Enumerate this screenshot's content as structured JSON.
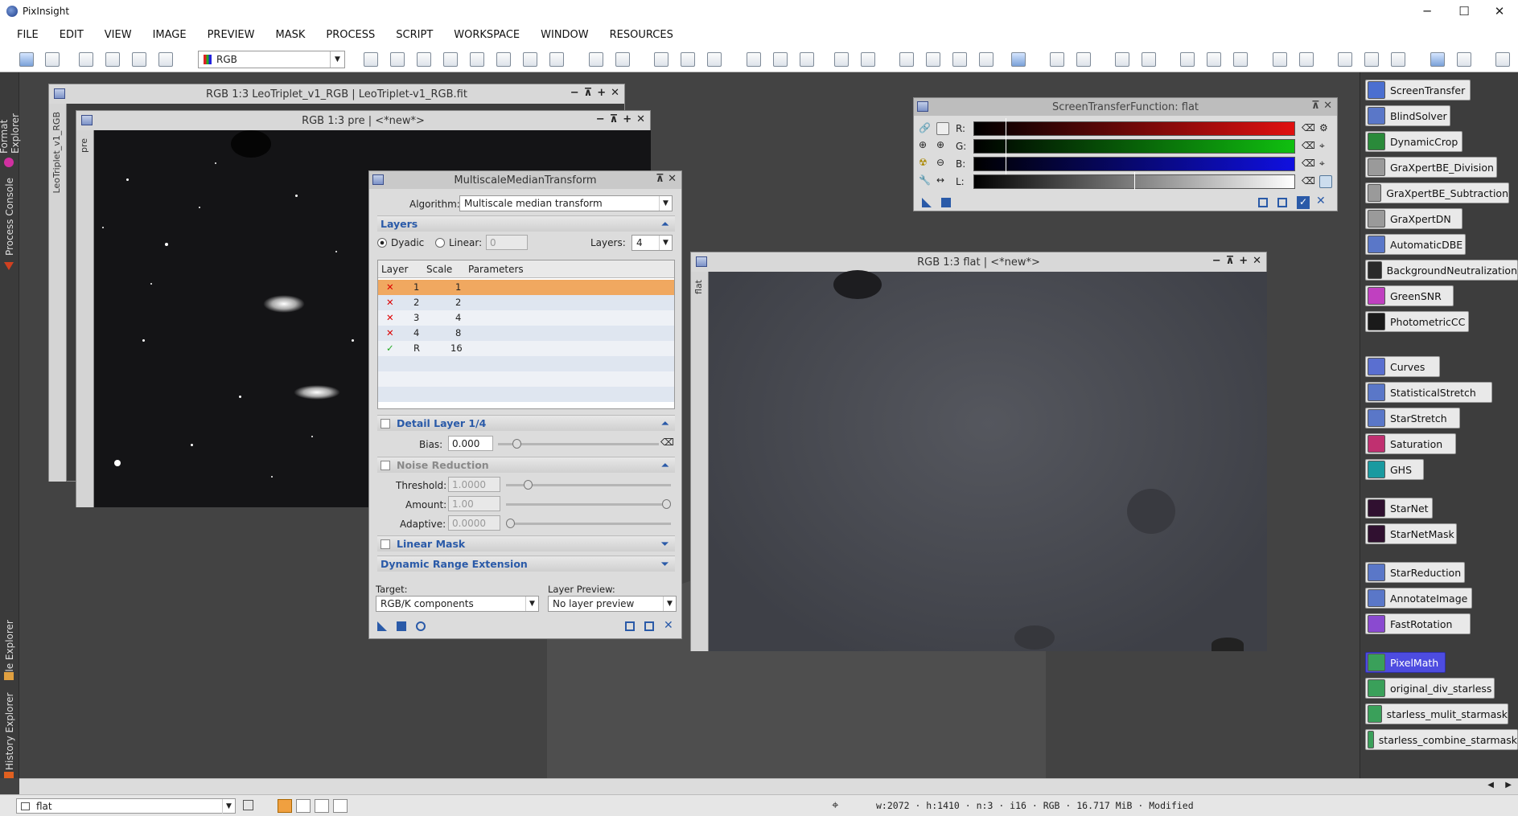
{
  "app": {
    "title": "PixInsight",
    "min": "─",
    "max": "☐",
    "close": "✕"
  },
  "menu": [
    "FILE",
    "EDIT",
    "VIEW",
    "IMAGE",
    "PREVIEW",
    "MASK",
    "PROCESS",
    "SCRIPT",
    "WORKSPACE",
    "WINDOW",
    "RESOURCES"
  ],
  "toolbar": {
    "colorspace": "RGB"
  },
  "left_tabs": [
    "Format Explorer",
    "Process Console",
    "File Explorer",
    "History Explorer"
  ],
  "windows": {
    "leo": {
      "title": "RGB 1:3 LeoTriplet_v1_RGB | LeoTriplet-v1_RGB.fit",
      "tab": "LeoTriplet_v1_RGB"
    },
    "pre": {
      "title": "RGB 1:3 pre | <*new*>",
      "tab": "pre"
    },
    "flat": {
      "title": "RGB 1:3 flat | <*new*>",
      "tab": "flat"
    },
    "btns": [
      "−",
      "⊼",
      "+",
      "✕"
    ]
  },
  "mmt": {
    "title": "MultiscaleMedianTransform",
    "algorithm_label": "Algorithm:",
    "algorithm": "Multiscale median transform",
    "layers_section": "Layers",
    "dyadic": "Dyadic",
    "linear": "Linear:",
    "linear_value": "0",
    "layers_label": "Layers:",
    "layers_value": "4",
    "table_headers": [
      "Layer",
      "Scale",
      "Parameters"
    ],
    "rows": [
      {
        "mark": "✕",
        "layer": "1",
        "scale": "1"
      },
      {
        "mark": "✕",
        "layer": "2",
        "scale": "2"
      },
      {
        "mark": "✕",
        "layer": "3",
        "scale": "4"
      },
      {
        "mark": "✕",
        "layer": "4",
        "scale": "8"
      },
      {
        "mark": "✓",
        "layer": "R",
        "scale": "16"
      }
    ],
    "detail_section": "Detail Layer 1/4",
    "bias_label": "Bias:",
    "bias": "0.000",
    "noise_section": "Noise Reduction",
    "threshold_label": "Threshold:",
    "threshold": "1.0000",
    "amount_label": "Amount:",
    "amount": "1.00",
    "adaptive_label": "Adaptive:",
    "adaptive": "0.0000",
    "linear_mask_section": "Linear Mask",
    "dre_section": "Dynamic Range Extension",
    "target_label": "Target:",
    "target": "RGB/K components",
    "preview_label": "Layer Preview:",
    "preview": "No layer preview"
  },
  "stf": {
    "title": "ScreenTransferFunction: flat",
    "channels": [
      "R:",
      "G:",
      "B:",
      "L:"
    ]
  },
  "process_icons": [
    {
      "label": "ScreenTransfer",
      "color": "#4b6fd0"
    },
    {
      "label": "BlindSolver",
      "color": "#5a77c8"
    },
    {
      "label": "DynamicCrop",
      "color": "#2a8a3a"
    },
    {
      "label": "GraXpertBE_Division",
      "color": "#9a9a9a"
    },
    {
      "label": "GraXpertBE_Subtraction",
      "color": "#9a9a9a"
    },
    {
      "label": "GraXpertDN",
      "color": "#9a9a9a"
    },
    {
      "label": "AutomaticDBE",
      "color": "#5a77c8"
    },
    {
      "label": "BackgroundNeutralization",
      "color": "#2a2a2a"
    },
    {
      "label": "GreenSNR",
      "color": "#c040c0"
    },
    {
      "label": "PhotometricCC",
      "color": "#1a1a1a"
    },
    {
      "label": "Curves",
      "color": "#5a6fd0"
    },
    {
      "label": "StatisticalStretch",
      "color": "#5a77c8"
    },
    {
      "label": "StarStretch",
      "color": "#5a77c8"
    },
    {
      "label": "Saturation",
      "color": "#c03070"
    },
    {
      "label": "GHS",
      "color": "#1a9aa0"
    },
    {
      "label": "StarNet",
      "color": "#301030"
    },
    {
      "label": "StarNetMask",
      "color": "#301030"
    },
    {
      "label": "StarReduction",
      "color": "#5a77c8"
    },
    {
      "label": "AnnotateImage",
      "color": "#5a77c8"
    },
    {
      "label": "FastRotation",
      "color": "#8a4ad0"
    },
    {
      "label": "PixelMath",
      "color": "#3aa05a"
    },
    {
      "label": "original_div_starless",
      "color": "#3aa05a"
    },
    {
      "label": "starless_mulit_starmask",
      "color": "#3aa05a"
    },
    {
      "label": "starless_combine_starmask",
      "color": "#3aa05a"
    }
  ],
  "status": {
    "view": "flat",
    "info": "w:2072 · h:1410 · n:3 · i16 · RGB · 16.717 MiB · Modified"
  }
}
